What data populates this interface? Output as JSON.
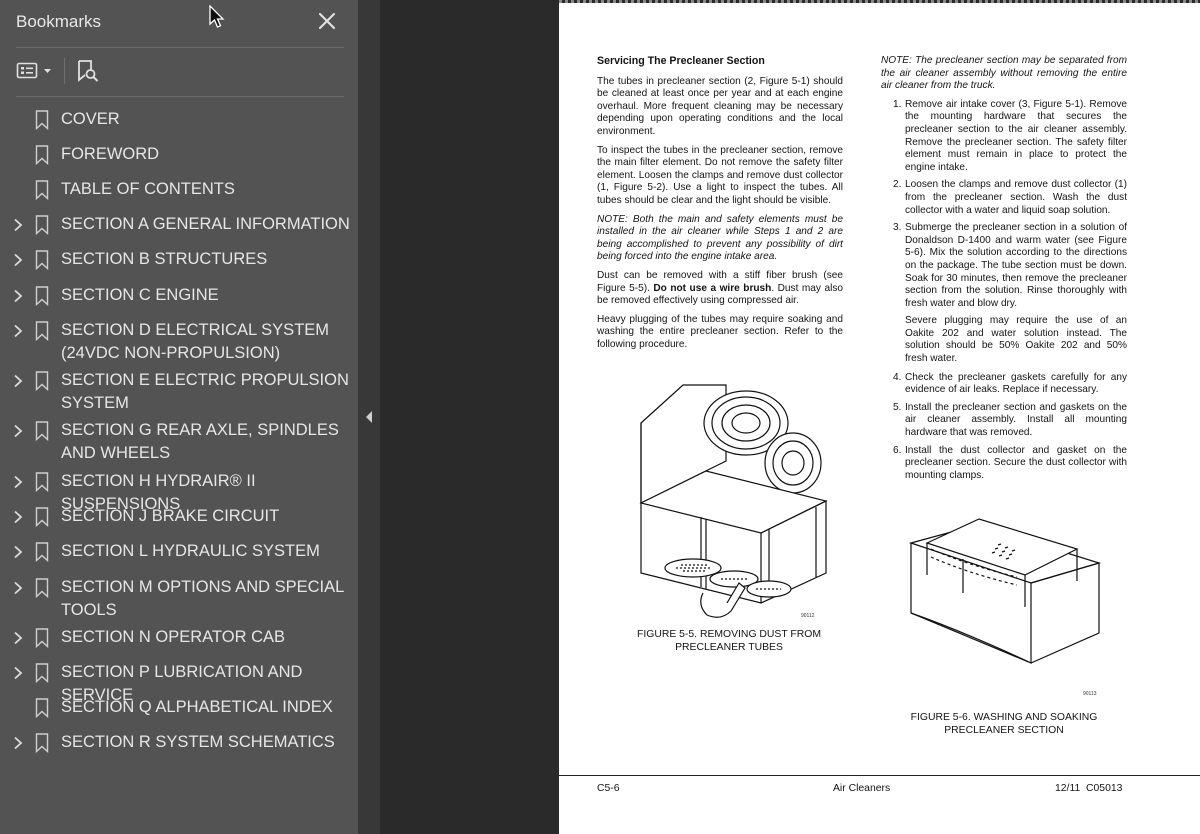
{
  "sidebar": {
    "title": "Bookmarks",
    "items": [
      {
        "label": "COVER",
        "expandable": false
      },
      {
        "label": "FOREWORD",
        "expandable": false
      },
      {
        "label": "TABLE OF CONTENTS",
        "expandable": false
      },
      {
        "label": "SECTION A GENERAL INFORMATION",
        "expandable": true
      },
      {
        "label": "SECTION B STRUCTURES",
        "expandable": true
      },
      {
        "label": "SECTION C ENGINE",
        "expandable": true
      },
      {
        "label": "SECTION D ELECTRICAL SYSTEM (24VDC NON-PROPULSION)",
        "expandable": true
      },
      {
        "label": "SECTION E ELECTRIC PROPULSION SYSTEM",
        "expandable": true
      },
      {
        "label": "SECTION G REAR AXLE, SPINDLES AND WHEELS",
        "expandable": true
      },
      {
        "label": "SECTION H HYDRAIR® II SUSPENSIONS",
        "expandable": true
      },
      {
        "label": "SECTION J BRAKE CIRCUIT",
        "expandable": true
      },
      {
        "label": "SECTION L HYDRAULIC SYSTEM",
        "expandable": true
      },
      {
        "label": "SECTION M OPTIONS AND SPECIAL TOOLS",
        "expandable": true
      },
      {
        "label": "SECTION N OPERATOR CAB",
        "expandable": true
      },
      {
        "label": "SECTION P LUBRICATION AND SERVICE",
        "expandable": true
      },
      {
        "label": "SECTION Q ALPHABETICAL INDEX",
        "expandable": false
      },
      {
        "label": "SECTION R SYSTEM SCHEMATICS",
        "expandable": true
      }
    ]
  },
  "icons": {
    "close": "close-icon",
    "options": "options-menu-icon",
    "find_bookmark": "find-bookmark-icon",
    "bookmark": "bookmark-icon",
    "expand": "chevron-right-icon",
    "collapse_panel": "collapse-left-icon",
    "cursor": "mouse-pointer-icon"
  },
  "document": {
    "left_col": {
      "heading": "Servicing The Precleaner Section",
      "p1": "The tubes in precleaner section (2, Figure 5-1) should be cleaned at least once per year and at each engine overhaul. More frequent cleaning may be necessary depending upon operating conditions and the local environment.",
      "p2": "To inspect the tubes in the precleaner section, remove the main filter element. Do not remove the safety filter element. Loosen the clamps and remove dust collector (1, Figure 5-2). Use a light to inspect the tubes. All tubes should be clear and the light should be visible.",
      "note": "NOTE: Both the main and safety elements must be installed in the air cleaner while Steps 1 and 2 are being accomplished to prevent any possibility of dirt being forced into the engine intake area.",
      "p3_a": "Dust can be removed with a stiff fiber brush (see Figure 5-5).",
      "p3_bold": "Do not use a wire brush",
      "p3_b": ". Dust may also be removed effectively using compressed air.",
      "p4": "Heavy plugging of the tubes may require soaking and washing the entire precleaner section. Refer to the following procedure."
    },
    "right_col": {
      "note": "NOTE: The precleaner section may be separated from the air cleaner assembly without removing the entire air cleaner from the truck.",
      "steps": [
        {
          "num": "1.",
          "text": "Remove air intake cover (3, Figure 5-1). Remove the mounting hardware that secures the precleaner section to the air cleaner assembly. Remove the precleaner section. The safety filter element must remain in place to protect the engine intake."
        },
        {
          "num": "2.",
          "text": "Loosen the clamps and remove dust collector (1) from the precleaner section. Wash the dust collector with a water and liquid soap solution."
        },
        {
          "num": "3.",
          "text": "Submerge the precleaner section in a solution of Donaldson D-1400 and warm water (see Figure 5-6). Mix the solution according to the directions on the package. The tube section must be down. Soak for 30 minutes, then remove the precleaner section from the solution. Rinse thoroughly with fresh water and blow dry."
        }
      ],
      "step3_extra": "Severe plugging may require the use of an Oakite 202 and water solution instead. The solution should be 50% Oakite 202 and 50% fresh water.",
      "steps2": [
        {
          "num": "4.",
          "text": "Check the precleaner gaskets carefully for any evidence of air leaks. Replace if necessary."
        },
        {
          "num": "5.",
          "text": "Install the precleaner section and gaskets on the air cleaner assembly. Install all mounting hardware that was removed."
        },
        {
          "num": "6.",
          "text": "Install the dust collector and gasket on the precleaner section. Secure the dust collector with mounting clamps."
        }
      ]
    },
    "figure1": {
      "code": "90112",
      "caption_l1": "FIGURE 5-5. REMOVING DUST FROM",
      "caption_l2": "PRECLEANER TUBES"
    },
    "figure2": {
      "code": "90113",
      "caption_l1": "FIGURE 5-6. WASHING AND SOAKING",
      "caption_l2": "PRECLEANER SECTION"
    },
    "footer": {
      "left": "C5-6",
      "center": "Air Cleaners",
      "right": "12/11  C05013"
    }
  }
}
